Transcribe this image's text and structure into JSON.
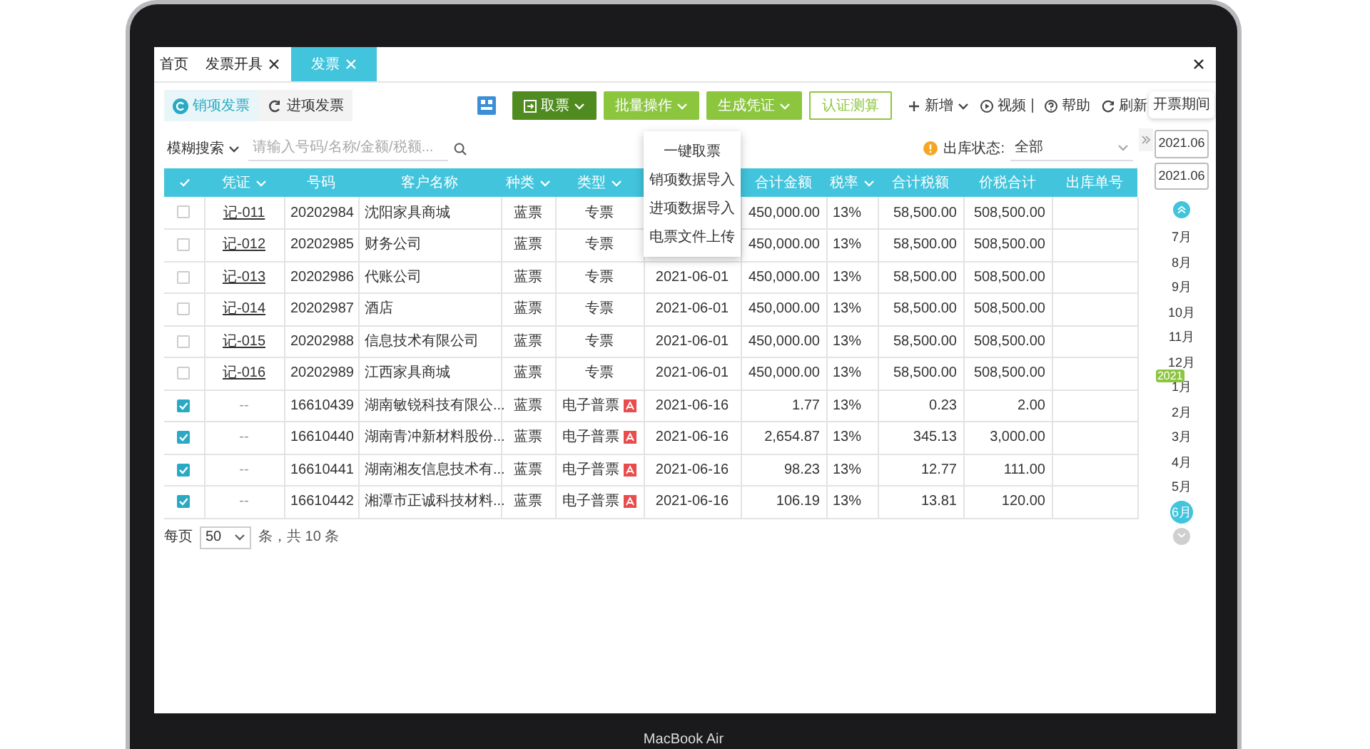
{
  "tabs": [
    {
      "label": "首页",
      "closable": false,
      "selected": false
    },
    {
      "label": "发票开具",
      "closable": true,
      "selected": false
    },
    {
      "label": "发票",
      "closable": true,
      "selected": true
    }
  ],
  "sub_tabs": [
    {
      "label": "销项发票",
      "selected": true
    },
    {
      "label": "进项发票",
      "selected": false
    }
  ],
  "toolbar": {
    "buttons": [
      {
        "label": "取票",
        "kind": "dropdown",
        "selected": true
      },
      {
        "label": "批量操作",
        "kind": "dropdown",
        "selected": false
      },
      {
        "label": "生成凭证",
        "kind": "dropdown",
        "selected": false
      },
      {
        "label": "认证测算",
        "kind": "outline",
        "selected": false
      }
    ],
    "links": [
      {
        "label": "新增",
        "kind": "add"
      },
      {
        "label": "视频",
        "kind": "video"
      },
      {
        "label": "帮助",
        "kind": "help"
      },
      {
        "label": "刷新",
        "kind": "refresh"
      }
    ],
    "period_button": "开票期间"
  },
  "dropdown_menu": [
    "一键取票",
    "销项数据导入",
    "进项数据导入",
    "电票文件上传"
  ],
  "filter": {
    "search_mode": "模糊搜索",
    "placeholder": "请输入号码/名称/金额/税额...",
    "status_label": "出库状态:",
    "status_value": "全部"
  },
  "table": {
    "columns": [
      {
        "label": "凭证",
        "filter": true
      },
      {
        "label": "号码",
        "filter": false
      },
      {
        "label": "客户名称",
        "filter": false
      },
      {
        "label": "种类",
        "filter": true
      },
      {
        "label": "类型",
        "filter": true
      },
      null,
      {
        "label": "合计金额",
        "filter": false
      },
      {
        "label": "税率",
        "filter": true
      },
      {
        "label": "合计税额",
        "filter": false
      },
      {
        "label": "价税合计",
        "filter": false
      },
      {
        "label": "出库单号",
        "filter": false
      }
    ],
    "rows": [
      {
        "checked": false,
        "linked": true,
        "pdf": false,
        "cells": [
          "记-011",
          "20202984",
          "沈阳家具商城",
          "蓝票",
          "专票",
          null,
          "450,000.00",
          "13%",
          "58,500.00",
          "508,500.00"
        ]
      },
      {
        "checked": false,
        "linked": true,
        "pdf": false,
        "cells": [
          "记-012",
          "20202985",
          "财务公司",
          "蓝票",
          "专票",
          null,
          "450,000.00",
          "13%",
          "58,500.00",
          "508,500.00"
        ]
      },
      {
        "checked": false,
        "linked": true,
        "pdf": false,
        "cells": [
          "记-013",
          "20202986",
          "代账公司",
          "蓝票",
          "专票",
          "2021-06-01",
          "450,000.00",
          "13%",
          "58,500.00",
          "508,500.00"
        ]
      },
      {
        "checked": false,
        "linked": true,
        "pdf": false,
        "cells": [
          "记-014",
          "20202987",
          "酒店",
          "蓝票",
          "专票",
          "2021-06-01",
          "450,000.00",
          "13%",
          "58,500.00",
          "508,500.00"
        ]
      },
      {
        "checked": false,
        "linked": true,
        "pdf": false,
        "cells": [
          "记-015",
          "20202988",
          "信息技术有限公司",
          "蓝票",
          "专票",
          "2021-06-01",
          "450,000.00",
          "13%",
          "58,500.00",
          "508,500.00"
        ]
      },
      {
        "checked": false,
        "linked": true,
        "pdf": false,
        "cells": [
          "记-016",
          "20202989",
          "江西家具商城",
          "蓝票",
          "专票",
          "2021-06-01",
          "450,000.00",
          "13%",
          "58,500.00",
          "508,500.00"
        ]
      },
      {
        "checked": true,
        "linked": false,
        "pdf": true,
        "cells": [
          "--",
          "16610439",
          "湖南敏锐科技有限公...",
          "蓝票",
          "电子普票",
          "2021-06-16",
          "1.77",
          "13%",
          "0.23",
          "2.00"
        ]
      },
      {
        "checked": true,
        "linked": false,
        "pdf": true,
        "cells": [
          "--",
          "16610440",
          "湖南青冲新材料股份...",
          "蓝票",
          "电子普票",
          "2021-06-16",
          "2,654.87",
          "13%",
          "345.13",
          "3,000.00"
        ]
      },
      {
        "checked": true,
        "linked": false,
        "pdf": true,
        "cells": [
          "--",
          "16610441",
          "湖南湘友信息技术有...",
          "蓝票",
          "电子普票",
          "2021-06-16",
          "98.23",
          "13%",
          "12.77",
          "111.00"
        ]
      },
      {
        "checked": true,
        "linked": false,
        "pdf": true,
        "cells": [
          "--",
          "16610442",
          "湘潭市正诚科技材料...",
          "蓝票",
          "电子普票",
          "2021-06-16",
          "106.19",
          "13%",
          "13.81",
          "120.00"
        ]
      }
    ]
  },
  "pagination": {
    "per_page_label": "每页",
    "per_page": "50",
    "summary": "条，共 10 条"
  },
  "calendar": {
    "fields": [
      "2021.06",
      "2021.06"
    ],
    "months": [
      {
        "label": "7月",
        "selected": false
      },
      {
        "label": "8月",
        "selected": false
      },
      {
        "label": "9月",
        "selected": false
      },
      {
        "label": "10月",
        "selected": false
      },
      {
        "label": "11月",
        "selected": false
      },
      {
        "label": "12月",
        "selected": false
      },
      {
        "label": "1月",
        "selected": false,
        "year_badge": "2021"
      },
      {
        "label": "2月",
        "selected": false
      },
      {
        "label": "3月",
        "selected": false
      },
      {
        "label": "4月",
        "selected": false
      },
      {
        "label": "5月",
        "selected": false
      },
      {
        "label": "6月",
        "selected": true
      }
    ]
  },
  "device_label": "MacBook Air"
}
